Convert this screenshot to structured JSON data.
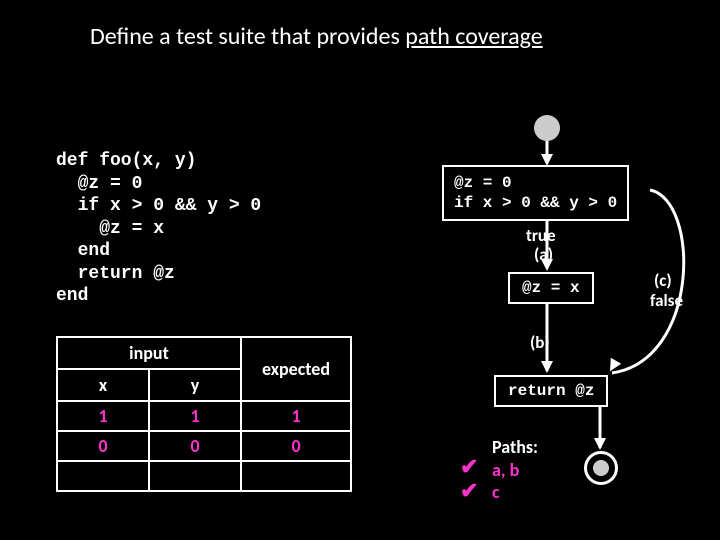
{
  "title_prefix": "Define a test suite that provides ",
  "title_underlined": "path coverage",
  "code_lines": "def foo(x, y)\n  @z = 0\n  if x > 0 && y > 0\n    @z = x\n  end\n  return @z\nend",
  "table": {
    "input_header": "input",
    "x_header": "x",
    "y_header": "y",
    "expected_header": "expected",
    "rows": [
      {
        "x": "1",
        "y": "1",
        "expected": "1"
      },
      {
        "x": "0",
        "y": "0",
        "expected": "0"
      }
    ]
  },
  "flow": {
    "box1": "@z = 0\nif x > 0 && y > 0",
    "box2": "@z = x",
    "box3": "return @z",
    "true": "true",
    "false": "false",
    "a": "(a)",
    "b": "(b)",
    "c": "(c)"
  },
  "paths": {
    "heading": "Paths:",
    "p1": "a, b",
    "p2": "c"
  },
  "check": "✔"
}
